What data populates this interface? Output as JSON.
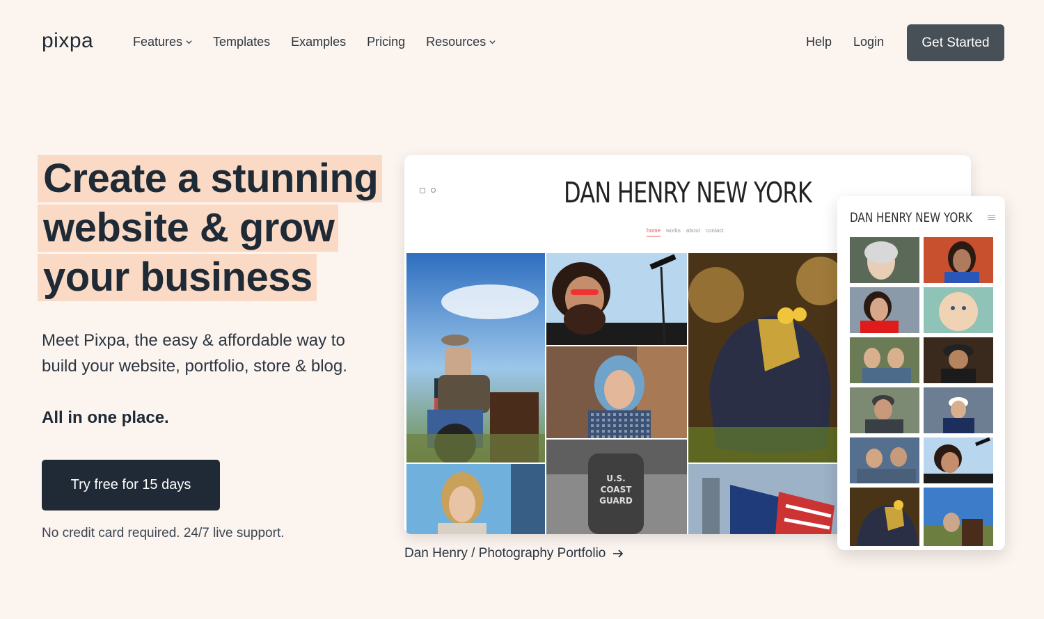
{
  "header": {
    "logo": "pixpa",
    "nav": [
      {
        "label": "Features",
        "has_dropdown": true,
        "icon": "chevron-down-icon"
      },
      {
        "label": "Templates",
        "has_dropdown": false
      },
      {
        "label": "Examples",
        "has_dropdown": false
      },
      {
        "label": "Pricing",
        "has_dropdown": false
      },
      {
        "label": "Resources",
        "has_dropdown": true,
        "icon": "chevron-down-icon"
      }
    ],
    "help": "Help",
    "login": "Login",
    "cta": "Get Started"
  },
  "hero": {
    "headline": [
      "Create a stunning",
      "website & grow",
      "your business"
    ],
    "subtitle": "Meet Pixpa, the easy & affordable way to build your website, portfolio, store & blog.",
    "subtitle_strong": "All in one place.",
    "cta": "Try free for 15 days",
    "note": "No credit card required. 24/7 live support."
  },
  "showcase": {
    "site_title": "DAN HENRY NEW YORK",
    "menu": [
      "home",
      "works",
      "about",
      "contact"
    ],
    "active_menu": "home",
    "mobile_title": "DAN HENRY NEW YORK",
    "caption": "Dan Henry / Photography Portfolio",
    "caption_icon": "arrow-right-icon",
    "accent": "#fbdac5",
    "button_dark": "#1f2a36",
    "button_gray": "#474f57"
  }
}
